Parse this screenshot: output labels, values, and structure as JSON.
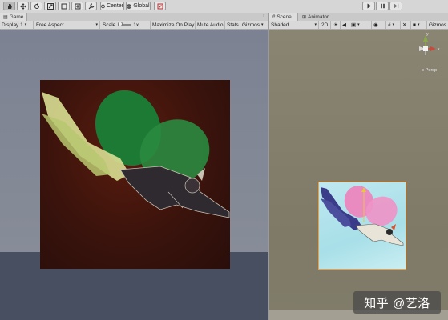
{
  "toolbar": {
    "tools": [
      {
        "name": "hand-tool",
        "icon": "hand-icon",
        "selected": true
      },
      {
        "name": "move-tool",
        "icon": "move-arrows-icon"
      },
      {
        "name": "rotate-tool",
        "icon": "rotate-icon"
      },
      {
        "name": "scale-tool",
        "icon": "scale-icon"
      },
      {
        "name": "rect-tool",
        "icon": "rect-icon"
      },
      {
        "name": "transform-tool",
        "icon": "transform-icon"
      },
      {
        "name": "custom-tool",
        "icon": "wrench-icon"
      }
    ],
    "pivot_label": "Center",
    "space_label": "Global",
    "play_controls": [
      "play-icon",
      "pause-icon",
      "step-icon"
    ]
  },
  "game": {
    "tab_label": "Game",
    "display_label": "Display 1",
    "aspect_label": "Free Aspect",
    "scale_label": "Scale",
    "scale_value": "1x",
    "maximize_label": "Maximize On Play",
    "mute_label": "Mute Audio",
    "stats_label": "Stats",
    "gizmos_label": "Gizmos"
  },
  "scene": {
    "tabs": [
      {
        "label": "Scene",
        "active": true
      },
      {
        "label": "Animator",
        "active": false
      }
    ],
    "shading_label": "Shaded",
    "mode_label": "2D",
    "gizmos_label": "Gizmos",
    "gizmo_axes": {
      "y": "y",
      "x": "x"
    },
    "projection_label": "≡ Persp"
  },
  "watermark": "知乎 @艺洛",
  "colors": {
    "game_background": "#7c8292",
    "game_floor": "#474f60",
    "scene_background": "#8a8472",
    "selection_outline": "#f0a040"
  }
}
